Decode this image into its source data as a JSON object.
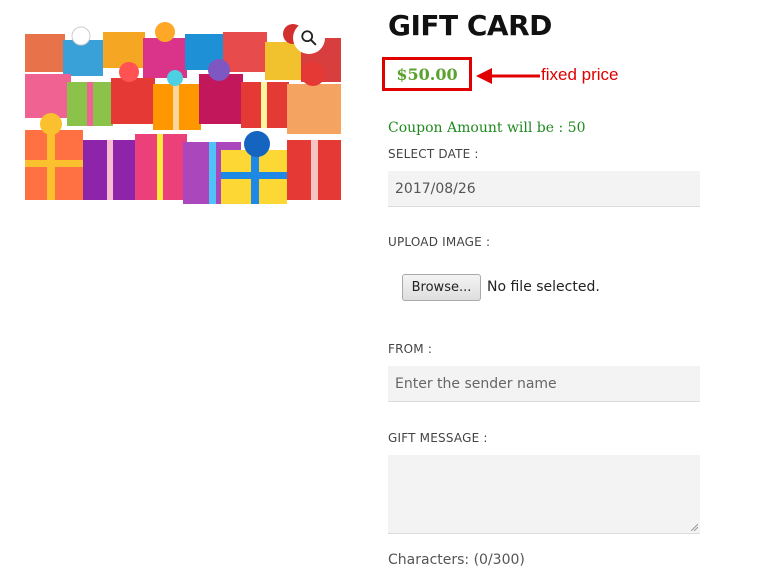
{
  "product": {
    "title": "GIFT CARD",
    "price": "$50.00",
    "annotation": "fixed price",
    "coupon_text": "Coupon Amount will be : 50",
    "image_icon": "zoom-icon"
  },
  "form": {
    "date_label": "SELECT DATE :",
    "date_value": "2017/08/26",
    "upload_label": "UPLOAD IMAGE :",
    "browse_label": "Browse...",
    "file_status": "No file selected.",
    "from_label": "FROM :",
    "from_placeholder": "Enter the sender name",
    "message_label": "GIFT MESSAGE :",
    "characters": "Characters: (0/300)"
  },
  "colors": {
    "price_green": "#5aa12d",
    "coupon_green": "#1f8a1f",
    "annotation_red": "#e00000"
  }
}
